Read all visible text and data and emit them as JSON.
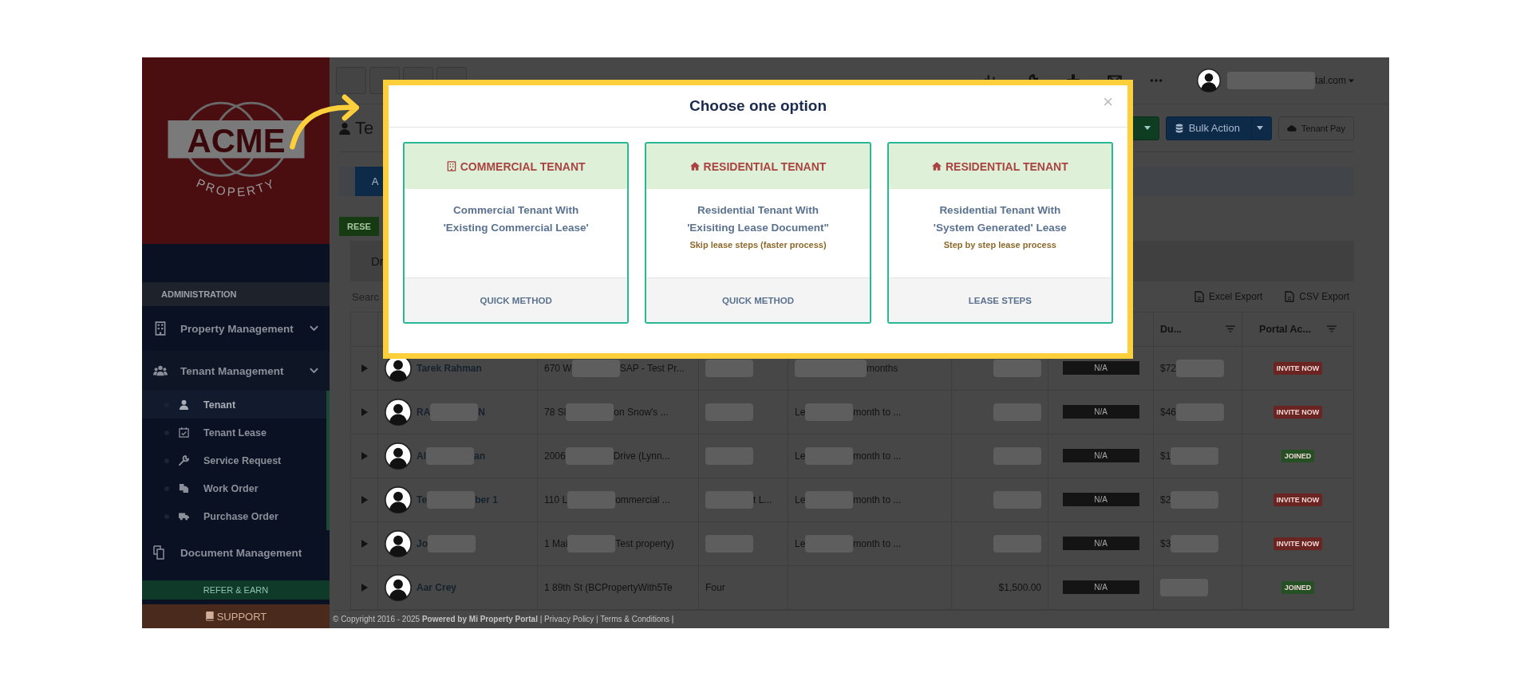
{
  "sidebar": {
    "logo": {
      "word": "ACME",
      "tagline": "PROPERTY"
    },
    "section_header": "ADMINISTRATION",
    "items": [
      {
        "label": "Property Management",
        "expanded": false
      },
      {
        "label": "Tenant Management",
        "expanded": true,
        "children": [
          {
            "label": "Tenant",
            "selected": true
          },
          {
            "label": "Tenant Lease",
            "selected": false
          },
          {
            "label": "Service Request",
            "selected": false
          },
          {
            "label": "Work Order",
            "selected": false
          },
          {
            "label": "Purchase Order",
            "selected": false
          }
        ]
      },
      {
        "label": "Document Management",
        "expanded": false
      }
    ],
    "refer_button": "REFER & EARN",
    "support_button": "SUPPORT"
  },
  "topbar": {
    "user_email": "tal.com"
  },
  "page": {
    "title": "Te",
    "actions": [
      {
        "label": "Bulk Action",
        "kind": "dropdown"
      },
      {
        "label": "Tenant Pay",
        "kind": "plain"
      }
    ],
    "tab": "A",
    "reserve_button": "RESE",
    "panel_label": "Dr",
    "search": {
      "placeholder": "Searc"
    },
    "exports": [
      "Excel Export",
      "CSV Export"
    ]
  },
  "table": {
    "columns": [
      "Du...",
      "Portal Ac..."
    ],
    "rows": [
      {
        "name": [
          "Tarek Rahman"
        ],
        "address": [
          "670 W",
          "SAP - Test Pr..."
        ],
        "column_3": [],
        "column_4": [
          "months"
        ],
        "column_5": [],
        "status": "N/A",
        "due": [
          "$72"
        ],
        "portal": {
          "label": "INVITE NOW",
          "color": "#6a2422"
        }
      },
      {
        "name": [
          "RA",
          "N"
        ],
        "address": [
          "78 Sl",
          "on Snow's ..."
        ],
        "column_3": [],
        "column_4": [
          "Le",
          "month to ..."
        ],
        "column_5": [],
        "status": "N/A",
        "due": [
          "$46"
        ],
        "portal": {
          "label": "INVITE NOW",
          "color": "#6a2422"
        }
      },
      {
        "name": [
          "Al",
          "an"
        ],
        "address": [
          "2006",
          "Drive (Lynn..."
        ],
        "column_3": [],
        "column_4": [
          "Le",
          "month to ..."
        ],
        "column_5": [],
        "status": "N/A",
        "due": [
          "$1"
        ],
        "portal": {
          "label": "JOINED",
          "color": "#245024"
        }
      },
      {
        "name": [
          "Te",
          "ber 1"
        ],
        "address": [
          "110 L",
          "ommercial ..."
        ],
        "column_3": [
          "t L..."
        ],
        "column_4": [
          "Le",
          "month to ..."
        ],
        "column_5": [],
        "status": "N/A",
        "due": [
          "$2"
        ],
        "portal": {
          "label": "INVITE NOW",
          "color": "#6a2422"
        }
      },
      {
        "name": [
          "Jo"
        ],
        "address": [
          "1 Mai",
          "Test property)"
        ],
        "column_3": [],
        "column_4": [
          "Le",
          "month to ..."
        ],
        "column_5": [],
        "status": "N/A",
        "due": [
          "$3"
        ],
        "portal": {
          "label": "INVITE NOW",
          "color": "#6a2422"
        }
      },
      {
        "name": [
          "Aar Crey"
        ],
        "address": [
          "1 89th St (BCPropertyWith5Te"
        ],
        "column_3": [
          "Four"
        ],
        "column_4": [],
        "column_5": [
          "$1,500.00"
        ],
        "status": "N/A",
        "due": [],
        "portal": {
          "label": "JOINED",
          "color": "#245024"
        }
      }
    ]
  },
  "footer": "© Copyright 2016 - 2025 **Powered by Mi Property Portal** | Privacy Policy | Terms & Conditions |",
  "modal": {
    "title": "Choose one option",
    "close": "×",
    "options": [
      {
        "kind": "commercial",
        "heading": "COMMERCIAL TENANT",
        "lines": [
          "Commercial Tenant With",
          "'Existing Commercial Lease'"
        ],
        "action": "QUICK METHOD"
      },
      {
        "kind": "residential",
        "heading": "RESIDENTIAL TENANT",
        "lines": [
          "Residential Tenant With",
          "'Exisiting Lease Document\""
        ],
        "note": "Skip lease steps (faster process)",
        "action": "QUICK METHOD"
      },
      {
        "kind": "residential",
        "heading": "RESIDENTIAL TENANT",
        "lines": [
          "Residential Tenant With",
          "'System Generated' Lease"
        ],
        "note": "Step by step lease process",
        "action": "LEASE STEPS"
      }
    ]
  }
}
